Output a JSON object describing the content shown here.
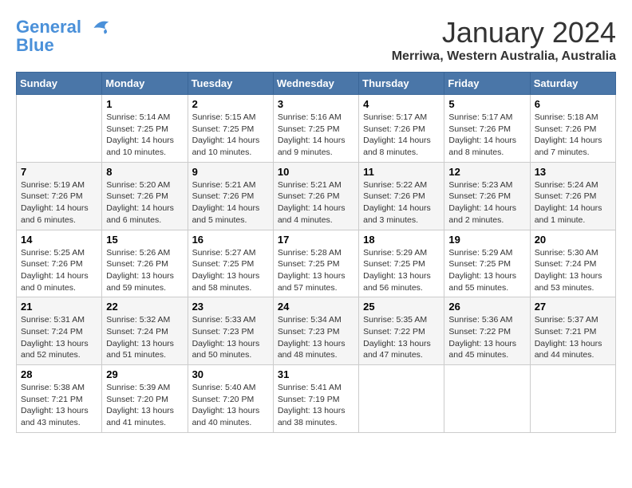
{
  "header": {
    "logo_line1": "General",
    "logo_line2": "Blue",
    "month_title": "January 2024",
    "subtitle": "Merriwa, Western Australia, Australia"
  },
  "days_of_week": [
    "Sunday",
    "Monday",
    "Tuesday",
    "Wednesday",
    "Thursday",
    "Friday",
    "Saturday"
  ],
  "weeks": [
    [
      {
        "day": "",
        "info": ""
      },
      {
        "day": "1",
        "info": "Sunrise: 5:14 AM\nSunset: 7:25 PM\nDaylight: 14 hours\nand 10 minutes."
      },
      {
        "day": "2",
        "info": "Sunrise: 5:15 AM\nSunset: 7:25 PM\nDaylight: 14 hours\nand 10 minutes."
      },
      {
        "day": "3",
        "info": "Sunrise: 5:16 AM\nSunset: 7:25 PM\nDaylight: 14 hours\nand 9 minutes."
      },
      {
        "day": "4",
        "info": "Sunrise: 5:17 AM\nSunset: 7:26 PM\nDaylight: 14 hours\nand 8 minutes."
      },
      {
        "day": "5",
        "info": "Sunrise: 5:17 AM\nSunset: 7:26 PM\nDaylight: 14 hours\nand 8 minutes."
      },
      {
        "day": "6",
        "info": "Sunrise: 5:18 AM\nSunset: 7:26 PM\nDaylight: 14 hours\nand 7 minutes."
      }
    ],
    [
      {
        "day": "7",
        "info": "Sunrise: 5:19 AM\nSunset: 7:26 PM\nDaylight: 14 hours\nand 6 minutes."
      },
      {
        "day": "8",
        "info": "Sunrise: 5:20 AM\nSunset: 7:26 PM\nDaylight: 14 hours\nand 6 minutes."
      },
      {
        "day": "9",
        "info": "Sunrise: 5:21 AM\nSunset: 7:26 PM\nDaylight: 14 hours\nand 5 minutes."
      },
      {
        "day": "10",
        "info": "Sunrise: 5:21 AM\nSunset: 7:26 PM\nDaylight: 14 hours\nand 4 minutes."
      },
      {
        "day": "11",
        "info": "Sunrise: 5:22 AM\nSunset: 7:26 PM\nDaylight: 14 hours\nand 3 minutes."
      },
      {
        "day": "12",
        "info": "Sunrise: 5:23 AM\nSunset: 7:26 PM\nDaylight: 14 hours\nand 2 minutes."
      },
      {
        "day": "13",
        "info": "Sunrise: 5:24 AM\nSunset: 7:26 PM\nDaylight: 14 hours\nand 1 minute."
      }
    ],
    [
      {
        "day": "14",
        "info": "Sunrise: 5:25 AM\nSunset: 7:26 PM\nDaylight: 14 hours\nand 0 minutes."
      },
      {
        "day": "15",
        "info": "Sunrise: 5:26 AM\nSunset: 7:26 PM\nDaylight: 13 hours\nand 59 minutes."
      },
      {
        "day": "16",
        "info": "Sunrise: 5:27 AM\nSunset: 7:25 PM\nDaylight: 13 hours\nand 58 minutes."
      },
      {
        "day": "17",
        "info": "Sunrise: 5:28 AM\nSunset: 7:25 PM\nDaylight: 13 hours\nand 57 minutes."
      },
      {
        "day": "18",
        "info": "Sunrise: 5:29 AM\nSunset: 7:25 PM\nDaylight: 13 hours\nand 56 minutes."
      },
      {
        "day": "19",
        "info": "Sunrise: 5:29 AM\nSunset: 7:25 PM\nDaylight: 13 hours\nand 55 minutes."
      },
      {
        "day": "20",
        "info": "Sunrise: 5:30 AM\nSunset: 7:24 PM\nDaylight: 13 hours\nand 53 minutes."
      }
    ],
    [
      {
        "day": "21",
        "info": "Sunrise: 5:31 AM\nSunset: 7:24 PM\nDaylight: 13 hours\nand 52 minutes."
      },
      {
        "day": "22",
        "info": "Sunrise: 5:32 AM\nSunset: 7:24 PM\nDaylight: 13 hours\nand 51 minutes."
      },
      {
        "day": "23",
        "info": "Sunrise: 5:33 AM\nSunset: 7:23 PM\nDaylight: 13 hours\nand 50 minutes."
      },
      {
        "day": "24",
        "info": "Sunrise: 5:34 AM\nSunset: 7:23 PM\nDaylight: 13 hours\nand 48 minutes."
      },
      {
        "day": "25",
        "info": "Sunrise: 5:35 AM\nSunset: 7:22 PM\nDaylight: 13 hours\nand 47 minutes."
      },
      {
        "day": "26",
        "info": "Sunrise: 5:36 AM\nSunset: 7:22 PM\nDaylight: 13 hours\nand 45 minutes."
      },
      {
        "day": "27",
        "info": "Sunrise: 5:37 AM\nSunset: 7:21 PM\nDaylight: 13 hours\nand 44 minutes."
      }
    ],
    [
      {
        "day": "28",
        "info": "Sunrise: 5:38 AM\nSunset: 7:21 PM\nDaylight: 13 hours\nand 43 minutes."
      },
      {
        "day": "29",
        "info": "Sunrise: 5:39 AM\nSunset: 7:20 PM\nDaylight: 13 hours\nand 41 minutes."
      },
      {
        "day": "30",
        "info": "Sunrise: 5:40 AM\nSunset: 7:20 PM\nDaylight: 13 hours\nand 40 minutes."
      },
      {
        "day": "31",
        "info": "Sunrise: 5:41 AM\nSunset: 7:19 PM\nDaylight: 13 hours\nand 38 minutes."
      },
      {
        "day": "",
        "info": ""
      },
      {
        "day": "",
        "info": ""
      },
      {
        "day": "",
        "info": ""
      }
    ]
  ]
}
